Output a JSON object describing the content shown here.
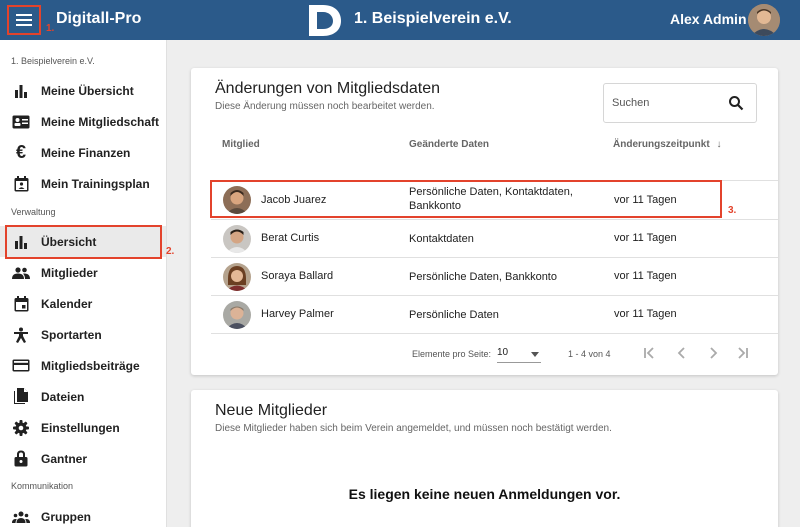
{
  "header": {
    "app_title": "Digitall-Pro",
    "club_title": "1. Beispielverein e.V.",
    "user_name": "Alex Admin",
    "bg_color": "#2b5a8a"
  },
  "annotations": [
    "1.",
    "2.",
    "3."
  ],
  "sidebar": {
    "club_label": "1. Beispielverein e.V.",
    "items_personal": [
      {
        "label": "Meine Übersicht",
        "icon": "bar-chart-icon"
      },
      {
        "label": "Meine Mitgliedschaft",
        "icon": "id-card-icon"
      },
      {
        "label": "Meine Finanzen",
        "icon": "euro-icon"
      },
      {
        "label": "Mein Trainingsplan",
        "icon": "calendar-person-icon"
      }
    ],
    "section_admin": "Verwaltung",
    "items_admin": [
      {
        "label": "Übersicht",
        "icon": "bar-chart-icon"
      },
      {
        "label": "Mitglieder",
        "icon": "people-icon"
      },
      {
        "label": "Kalender",
        "icon": "calendar-icon"
      },
      {
        "label": "Sportarten",
        "icon": "person-sport-icon"
      },
      {
        "label": "Mitgliedsbeiträge",
        "icon": "credit-card-icon"
      },
      {
        "label": "Dateien",
        "icon": "files-icon"
      },
      {
        "label": "Einstellungen",
        "icon": "gear-icon"
      },
      {
        "label": "Gantner",
        "icon": "lock-icon"
      }
    ],
    "section_comm": "Kommunikation",
    "items_comm": [
      {
        "label": "Gruppen",
        "icon": "groups-icon"
      }
    ]
  },
  "changes_card": {
    "title": "Änderungen von Mitgliedsdaten",
    "subtitle": "Diese Änderung müssen noch bearbeitet werden.",
    "search_placeholder": "Suchen",
    "columns": {
      "member": "Mitglied",
      "changed": "Geänderte Daten",
      "time": "Änderungszeitpunkt"
    },
    "sort_icon": "arrow-down-icon",
    "rows": [
      {
        "name": "Jacob Juarez",
        "changes": "Persönliche Daten, Kontaktdaten, Bankkonto",
        "time": "vor 11 Tagen"
      },
      {
        "name": "Berat Curtis",
        "changes": "Kontaktdaten",
        "time": "vor 11 Tagen"
      },
      {
        "name": "Soraya Ballard",
        "changes": "Persönliche Daten, Bankkonto",
        "time": "vor 11 Tagen"
      },
      {
        "name": "Harvey Palmer",
        "changes": "Persönliche Daten",
        "time": "vor 11 Tagen"
      }
    ],
    "pager": {
      "per_page_label": "Elemente pro Seite:",
      "per_page_value": "10",
      "range": "1 - 4 von 4"
    }
  },
  "new_members_card": {
    "title": "Neue Mitglieder",
    "subtitle": "Diese Mitglieder haben sich beim Verein angemeldet, und müssen noch bestätigt werden.",
    "empty_message": "Es liegen keine neuen Anmeldungen vor."
  }
}
